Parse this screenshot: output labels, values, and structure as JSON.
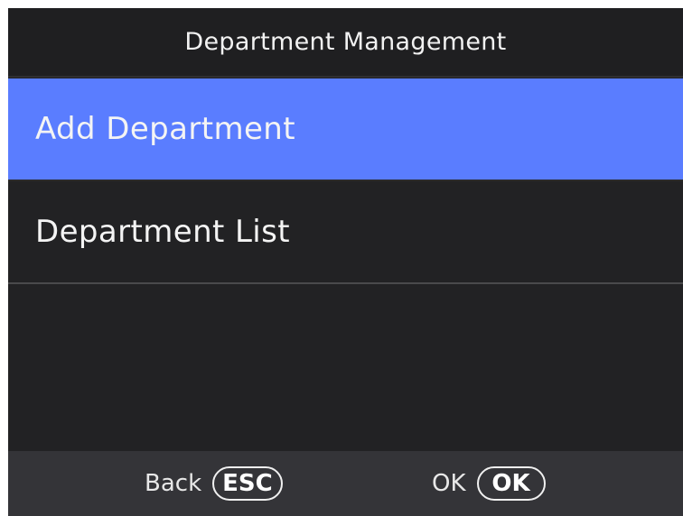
{
  "header": {
    "title": "Department Management"
  },
  "menu": {
    "items": [
      {
        "label": "Add Department",
        "selected": true
      },
      {
        "label": "Department List",
        "selected": false
      }
    ]
  },
  "footer": {
    "back_label": "Back",
    "back_key": "ESC",
    "ok_label": "OK",
    "ok_key": "OK"
  },
  "colors": {
    "selected_item": "#5a7dff",
    "background": "#222224",
    "footer": "#343438"
  }
}
